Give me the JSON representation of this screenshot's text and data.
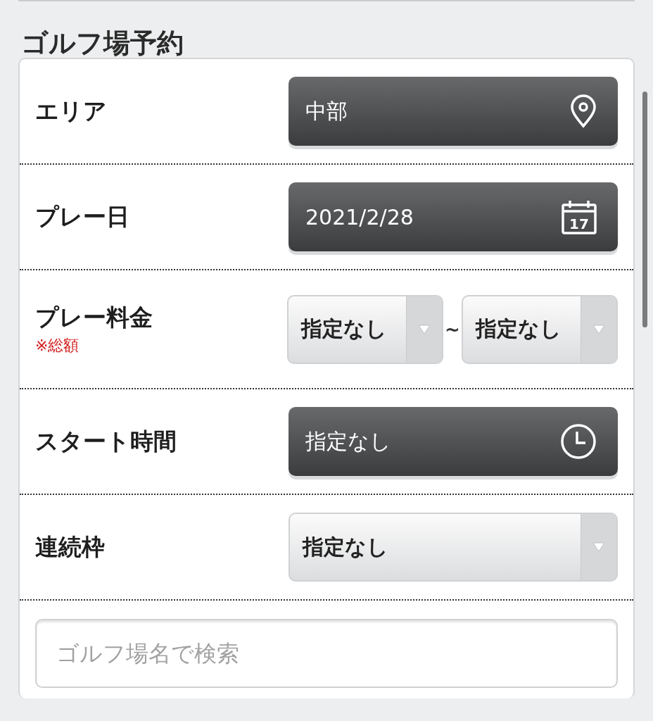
{
  "title": "ゴルフ場予約",
  "rows": [
    {
      "kind": "location",
      "label": "エリア",
      "value": "中部"
    },
    {
      "kind": "date",
      "label": "プレー日",
      "value": "2021/2/28",
      "icon_text": "17"
    },
    {
      "kind": "range",
      "label": "プレー料金",
      "note": "※総額",
      "from": "指定なし",
      "separator": "~",
      "to": "指定なし"
    },
    {
      "kind": "time",
      "label": "スタート時間",
      "value": "指定なし"
    },
    {
      "kind": "select",
      "label": "連続枠",
      "value": "指定なし"
    }
  ],
  "search": {
    "placeholder": "ゴルフ場名で検索"
  }
}
